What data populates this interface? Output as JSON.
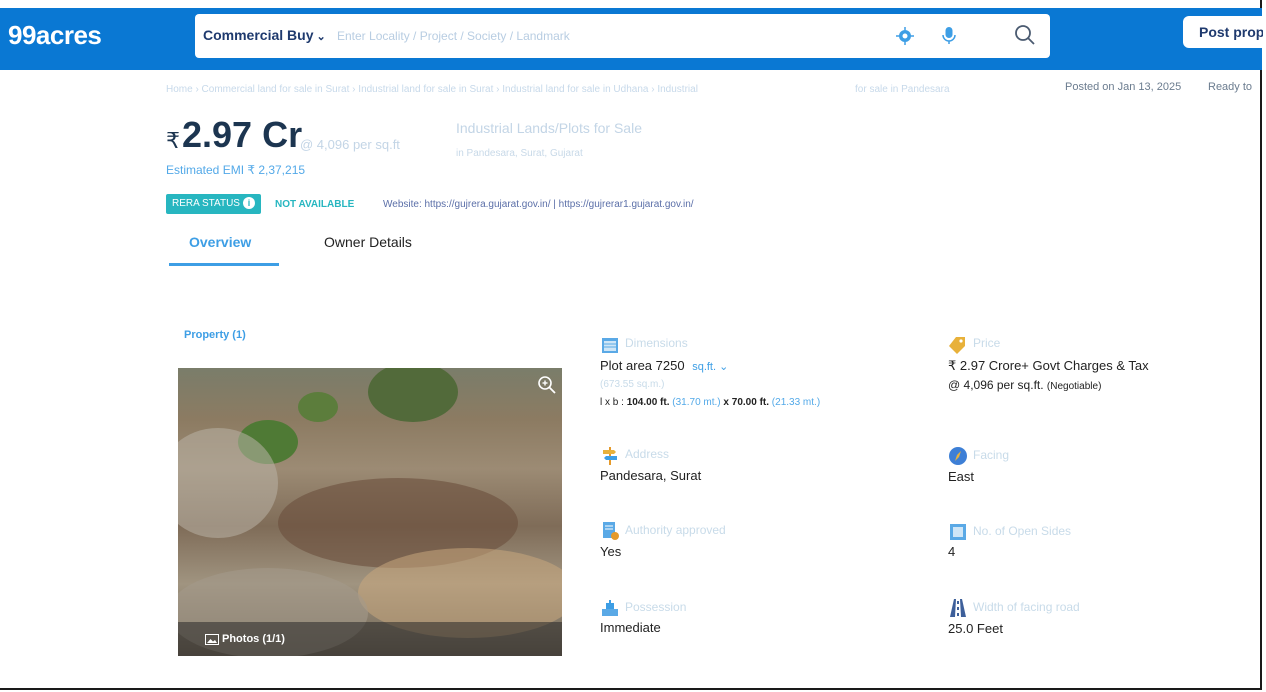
{
  "header": {
    "logo": "99acres",
    "search_type": "Commercial Buy",
    "search_placeholder": "Enter Locality / Project / Society / Landmark",
    "post_button": "Post prop"
  },
  "breadcrumb": {
    "path": "Home › Commercial land for sale in Surat › Industrial land for sale in Surat › Industrial land for sale in Udhana › Industrial",
    "tail": "for sale in Pandesara"
  },
  "meta": {
    "posted": "Posted on Jan 13, 2025",
    "ready": "Ready to"
  },
  "price": {
    "currency": "₹",
    "amount": "2.97 Cr",
    "per_sqft": "@ 4,096 per sq.ft",
    "emi": "Estimated EMI ₹ 2,37,215"
  },
  "property": {
    "title": "Industrial Lands/Plots for Sale",
    "location": "in Pandesara, Surat, Gujarat"
  },
  "rera": {
    "badge": "RERA STATUS",
    "status": "NOT AVAILABLE",
    "website": "Website: https://gujrera.gujarat.gov.in/ | https://gujrerar1.gujarat.gov.in/"
  },
  "tabs": [
    {
      "label": "Overview",
      "active": true
    },
    {
      "label": "Owner Details",
      "active": false
    }
  ],
  "section": {
    "label": "Property (1)"
  },
  "photo": {
    "count_label": "Photos (1/1)"
  },
  "details": {
    "dimensions": {
      "label": "Dimensions",
      "value": "Plot area 7250",
      "unit": "sq.ft.",
      "sub": "(673.55 sq.m.)",
      "lxb_prefix": "l x b :",
      "length": "104.00 ft.",
      "length_m": "(31.70 mt.)",
      "sep": "x",
      "breadth": "70.00 ft.",
      "breadth_m": "(21.33 mt.)"
    },
    "price": {
      "label": "Price",
      "value": "₹ 2.97 Crore+ Govt Charges & Tax",
      "per": "@ 4,096 per sq.ft.",
      "neg": "(Negotiable)"
    },
    "address": {
      "label": "Address",
      "value": "Pandesara, Surat"
    },
    "facing": {
      "label": "Facing",
      "value": "East"
    },
    "authority": {
      "label": "Authority approved",
      "value": "Yes"
    },
    "open_sides": {
      "label": "No. of Open Sides",
      "value": "4"
    },
    "possession": {
      "label": "Possession",
      "value": "Immediate"
    },
    "road": {
      "label": "Width of facing road",
      "value": "25.0 Feet"
    }
  },
  "colors": {
    "brand_blue": "#0a78d3",
    "accent_blue": "#3d9ee5",
    "rera_teal": "#27b6c0"
  }
}
